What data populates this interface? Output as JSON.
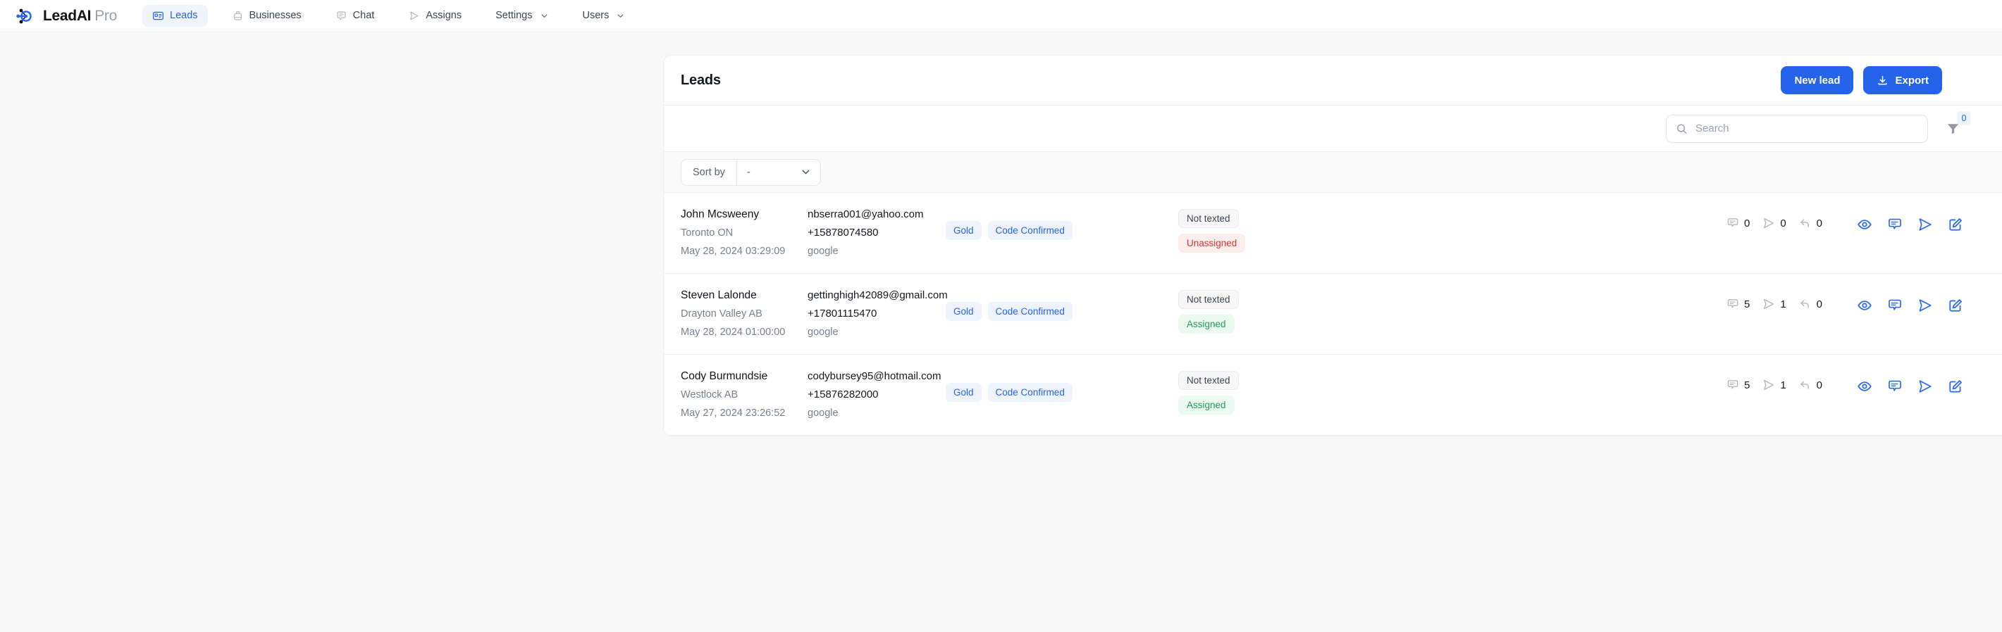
{
  "brand": {
    "name": "LeadAI",
    "suffix": "Pro",
    "icon": "network-node-icon"
  },
  "nav": {
    "items": [
      {
        "label": "Leads",
        "icon": "id-card-icon",
        "active": true,
        "caret": false
      },
      {
        "label": "Businesses",
        "icon": "briefcase-icon",
        "active": false,
        "caret": false
      },
      {
        "label": "Chat",
        "icon": "chat-bubble-icon",
        "active": false,
        "caret": false
      },
      {
        "label": "Assigns",
        "icon": "send-icon",
        "active": false,
        "caret": false
      },
      {
        "label": "Settings",
        "icon": "",
        "active": false,
        "caret": true
      },
      {
        "label": "Users",
        "icon": "",
        "active": false,
        "caret": true
      }
    ]
  },
  "card": {
    "title": "Leads",
    "new_lead_label": "New lead",
    "export_label": "Export",
    "export_icon": "download-icon"
  },
  "search": {
    "placeholder": "Search",
    "value": "",
    "icon": "search-icon",
    "filter_icon": "filter-funnel-icon",
    "filter_count": "0"
  },
  "sort": {
    "label": "Sort by",
    "value": "-",
    "caret_icon": "chevron-down-icon"
  },
  "table": {
    "action_icons": [
      "eye-icon",
      "chat-bubble-icon",
      "send-icon",
      "edit-pencil-icon"
    ],
    "count_icons": [
      "chat-bubble-icon",
      "send-icon",
      "reply-arrow-icon"
    ],
    "rows": [
      {
        "name": "John Mcsweeny",
        "location": "Toronto ON",
        "created": "May 28, 2024 03:29:09",
        "email": "nbserra001@yahoo.com",
        "phone": "+15878074580",
        "source": "google",
        "tags": [
          "Gold",
          "Code Confirmed"
        ],
        "text_status": "Not texted",
        "assign_status": "Unassigned",
        "assign_state": "danger",
        "counts": [
          "0",
          "0",
          "0"
        ]
      },
      {
        "name": "Steven Lalonde",
        "location": "Drayton Valley AB",
        "created": "May 28, 2024 01:00:00",
        "email": "gettinghigh42089@gmail.com",
        "phone": "+17801115470",
        "source": "google",
        "tags": [
          "Gold",
          "Code Confirmed"
        ],
        "text_status": "Not texted",
        "assign_status": "Assigned",
        "assign_state": "success",
        "counts": [
          "5",
          "1",
          "0"
        ]
      },
      {
        "name": "Cody Burmundsie",
        "location": "Westlock AB",
        "created": "May 27, 2024 23:26:52",
        "email": "codybursey95@hotmail.com",
        "phone": "+15876282000",
        "source": "google",
        "tags": [
          "Gold",
          "Code Confirmed"
        ],
        "text_status": "Not texted",
        "assign_status": "Assigned",
        "assign_state": "success",
        "counts": [
          "5",
          "1",
          "0"
        ]
      }
    ]
  },
  "colors": {
    "accent": "#2563eb",
    "page_bg": "#f8f8f9",
    "danger": "#e0352b",
    "success": "#1f9d54"
  }
}
